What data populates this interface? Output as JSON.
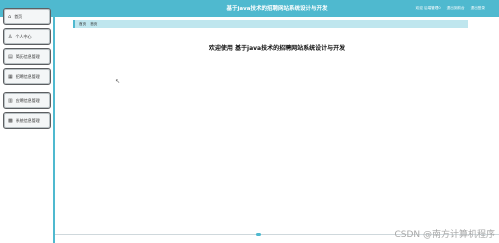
{
  "header": {
    "title": "基于java技术的招聘网站系统设计与开发",
    "actions": [
      "欢迎 后端管理0",
      "退出到前台",
      "退出登录"
    ]
  },
  "sidebar": {
    "items": [
      {
        "label": "首页",
        "icon": "home-icon",
        "glyph": "⌂"
      },
      {
        "label": "个人中心",
        "icon": "user-icon",
        "glyph": "♙"
      },
      {
        "label": "简历信息管理",
        "icon": "resume-icon",
        "glyph": "▤"
      },
      {
        "label": "招聘信息管理",
        "icon": "job-icon",
        "glyph": "▦"
      },
      {
        "label": "应聘信息管理",
        "icon": "application-icon",
        "glyph": "▥"
      },
      {
        "label": "系统信息管理",
        "icon": "system-icon",
        "glyph": "▩"
      }
    ]
  },
  "breadcrumb": {
    "items": [
      "首页",
      "首页"
    ]
  },
  "main": {
    "welcome_text": "欢迎使用 基于java技术的招聘网站系统设计与开发"
  },
  "watermark": "CSDN @南方计算机程序",
  "colors": {
    "accent": "#4fb9cf",
    "breadcrumb_bg": "#bfe6ee"
  }
}
